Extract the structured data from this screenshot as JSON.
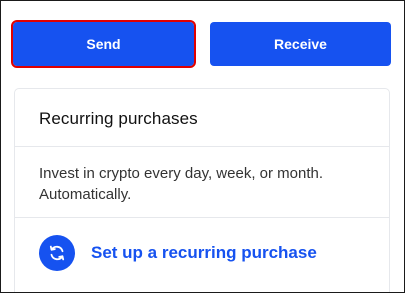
{
  "actions": {
    "send_label": "Send",
    "receive_label": "Receive"
  },
  "recurring": {
    "title": "Recurring purchases",
    "description": "Invest in crypto every day, week, or month. Automatically.",
    "setup_label": "Set up a recurring purchase",
    "setup_icon": "recurring-arrows-icon"
  },
  "colors": {
    "primary": "#1652f0",
    "highlight_outline": "#e00000",
    "border": "#e6e8ec"
  }
}
